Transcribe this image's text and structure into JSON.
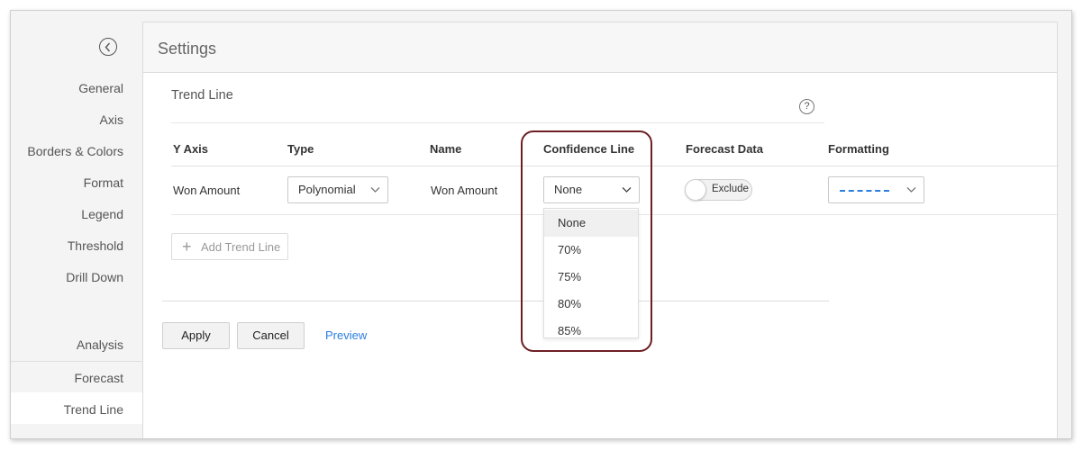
{
  "sidebar": {
    "nav_items": [
      "General",
      "Axis",
      "Borders & Colors",
      "Format",
      "Legend",
      "Threshold",
      "Drill Down"
    ],
    "section_label": "Analysis",
    "analysis_items": [
      "Forecast",
      "Trend Line"
    ],
    "active_item": "Trend Line"
  },
  "header": {
    "title": "Settings"
  },
  "trend_line": {
    "section_title": "Trend Line",
    "help_glyph": "?",
    "columns": [
      "Y Axis",
      "Type",
      "Name",
      "Confidence Line",
      "Forecast Data",
      "Formatting"
    ],
    "row": {
      "y_axis": "Won Amount",
      "type": "Polynomial",
      "name": "Won Amount",
      "confidence": "None",
      "forecast": "Exclude",
      "formatting_style": "dashed",
      "formatting_color": "#2a7de1"
    },
    "add_button": "Add Trend Line",
    "confidence_options": [
      "None",
      "70%",
      "75%",
      "80%",
      "85%"
    ]
  },
  "footer": {
    "apply": "Apply",
    "cancel": "Cancel",
    "preview": "Preview"
  },
  "colors": {
    "highlight": "#6d1f24",
    "link": "#2a7de1"
  }
}
